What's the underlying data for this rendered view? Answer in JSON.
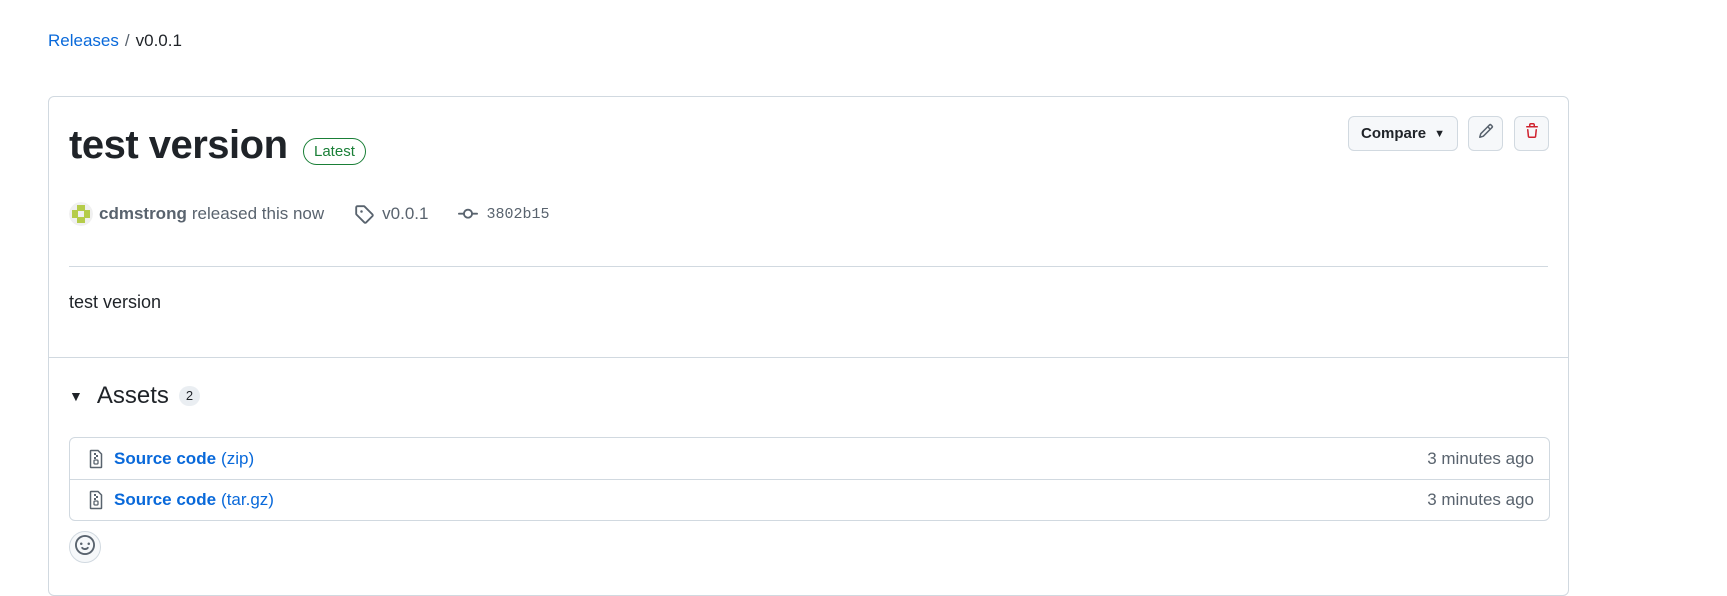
{
  "breadcrumb": {
    "parent": "Releases",
    "separator": "/",
    "current": "v0.0.1"
  },
  "release": {
    "title": "test version",
    "badge": "Latest",
    "author": "cdmstrong",
    "action": "released this now",
    "tag": "v0.0.1",
    "commit": "3802b15",
    "body": "test version"
  },
  "actions": {
    "compare_label": "Compare",
    "edit_icon": "pencil-icon",
    "delete_icon": "trash-icon"
  },
  "assets": {
    "title": "Assets",
    "count": "2",
    "items": [
      {
        "name": "Source code",
        "ext": "(zip)",
        "time": "3 minutes ago"
      },
      {
        "name": "Source code",
        "ext": "(tar.gz)",
        "time": "3 minutes ago"
      }
    ]
  },
  "colors": {
    "link": "#0969da",
    "latest": "#1a7f37",
    "danger": "#cf222e",
    "muted": "#59636e",
    "border": "#d1d9e0"
  }
}
